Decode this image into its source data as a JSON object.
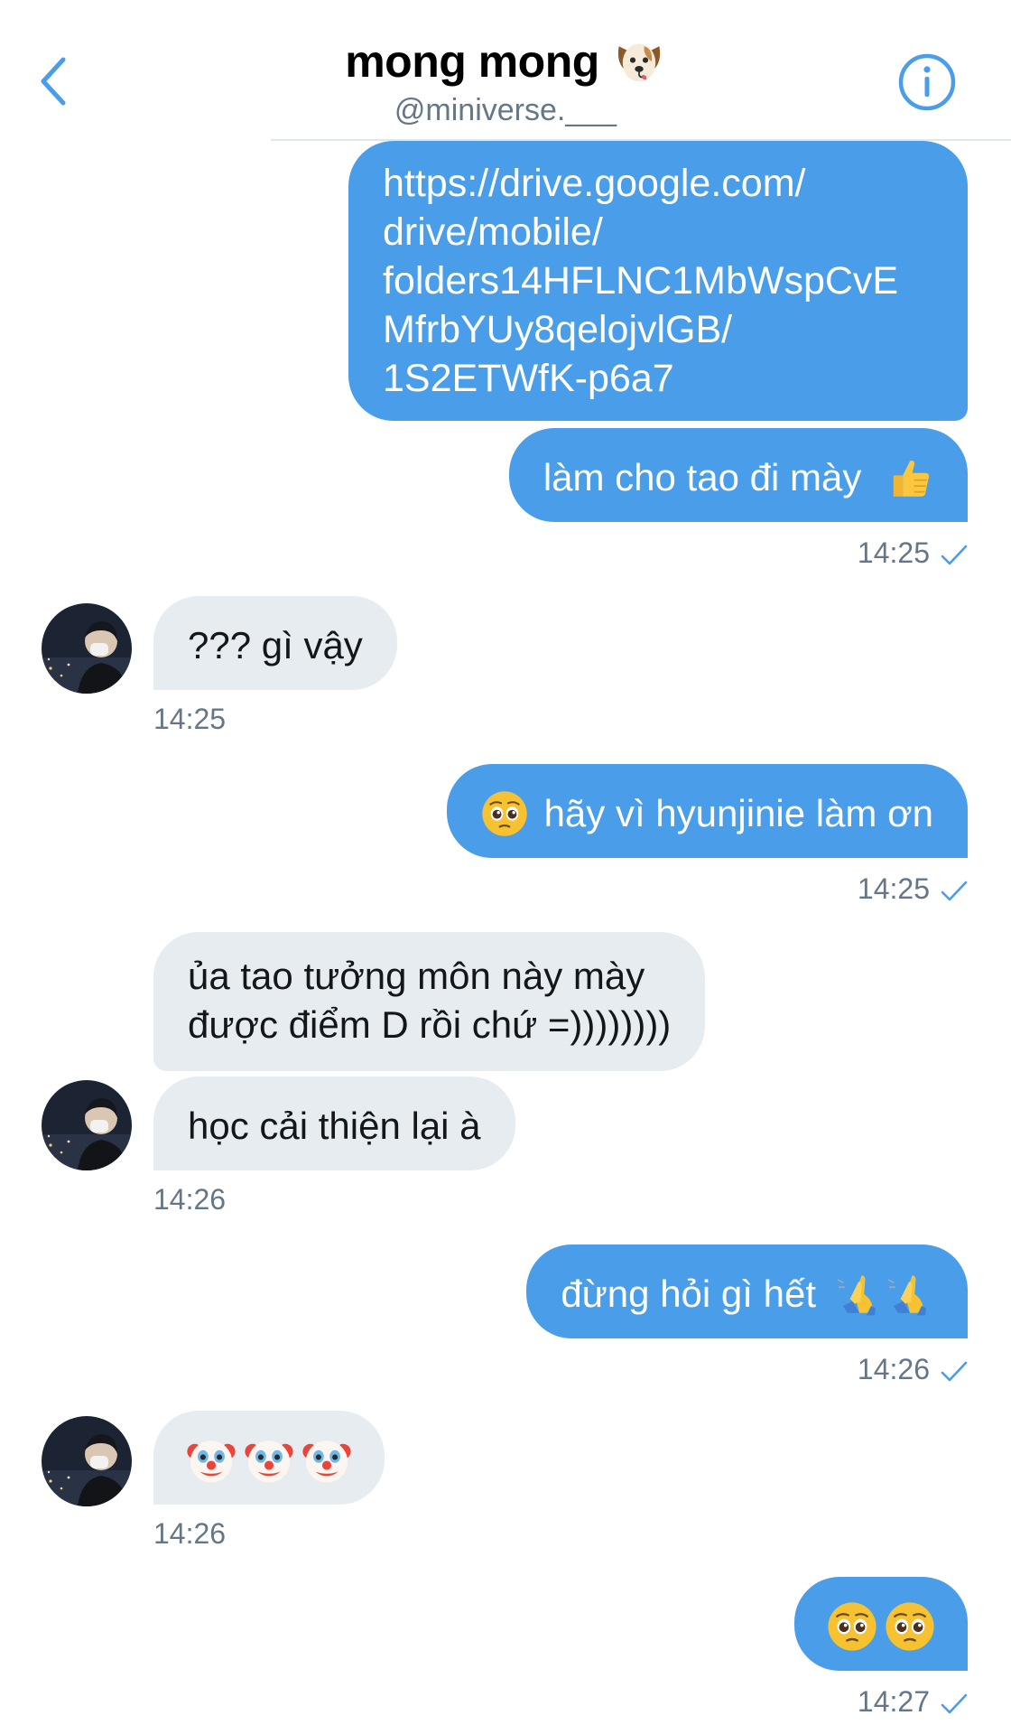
{
  "header": {
    "title": "mong mong",
    "title_emoji": "dog-face-emoji",
    "handle": "@miniverse.___",
    "back_icon": "chevron-left-icon",
    "info_icon": "info-icon",
    "accent_color": "#4a9ee9"
  },
  "colors": {
    "outgoing_bubble": "#4a9ee9",
    "incoming_bubble": "#e6ecf0",
    "timestamp": "#657786",
    "checkmark": "#4a9ee9"
  },
  "messages": [
    {
      "direction": "outgoing",
      "lines": [
        "https://drive.google.com/",
        "drive/mobile/",
        "folders14HFLNC1MbWspCvE",
        "MfrbYUy8qelojvlGB/",
        "1S2ETWfK-p6a7"
      ]
    },
    {
      "direction": "outgoing",
      "text": "làm cho tao đi mày",
      "emojis": [
        "thumbs-up-emoji"
      ],
      "time": "14:25"
    },
    {
      "direction": "incoming",
      "text": "??? gì vậy",
      "time": "14:25"
    },
    {
      "direction": "outgoing",
      "text": "hãy vì hyunjinie làm ơn",
      "emojis": [
        "pleading-face-emoji"
      ],
      "time": "14:25"
    },
    {
      "direction": "incoming",
      "lines": [
        "ủa tao tưởng môn này mày",
        "được điểm D rồi chứ =))))))))"
      ]
    },
    {
      "direction": "incoming",
      "text": "học cải thiện lại à",
      "time": "14:26"
    },
    {
      "direction": "outgoing",
      "text": "đừng hỏi gì hết",
      "emojis": [
        "person-praying-emoji",
        "person-praying-emoji"
      ],
      "time": "14:26"
    },
    {
      "direction": "incoming",
      "emojis": [
        "clown-face-emoji",
        "clown-face-emoji",
        "clown-face-emoji"
      ],
      "time": "14:26"
    },
    {
      "direction": "outgoing",
      "emojis": [
        "pleading-face-emoji",
        "pleading-face-emoji"
      ],
      "time": "14:27"
    }
  ]
}
